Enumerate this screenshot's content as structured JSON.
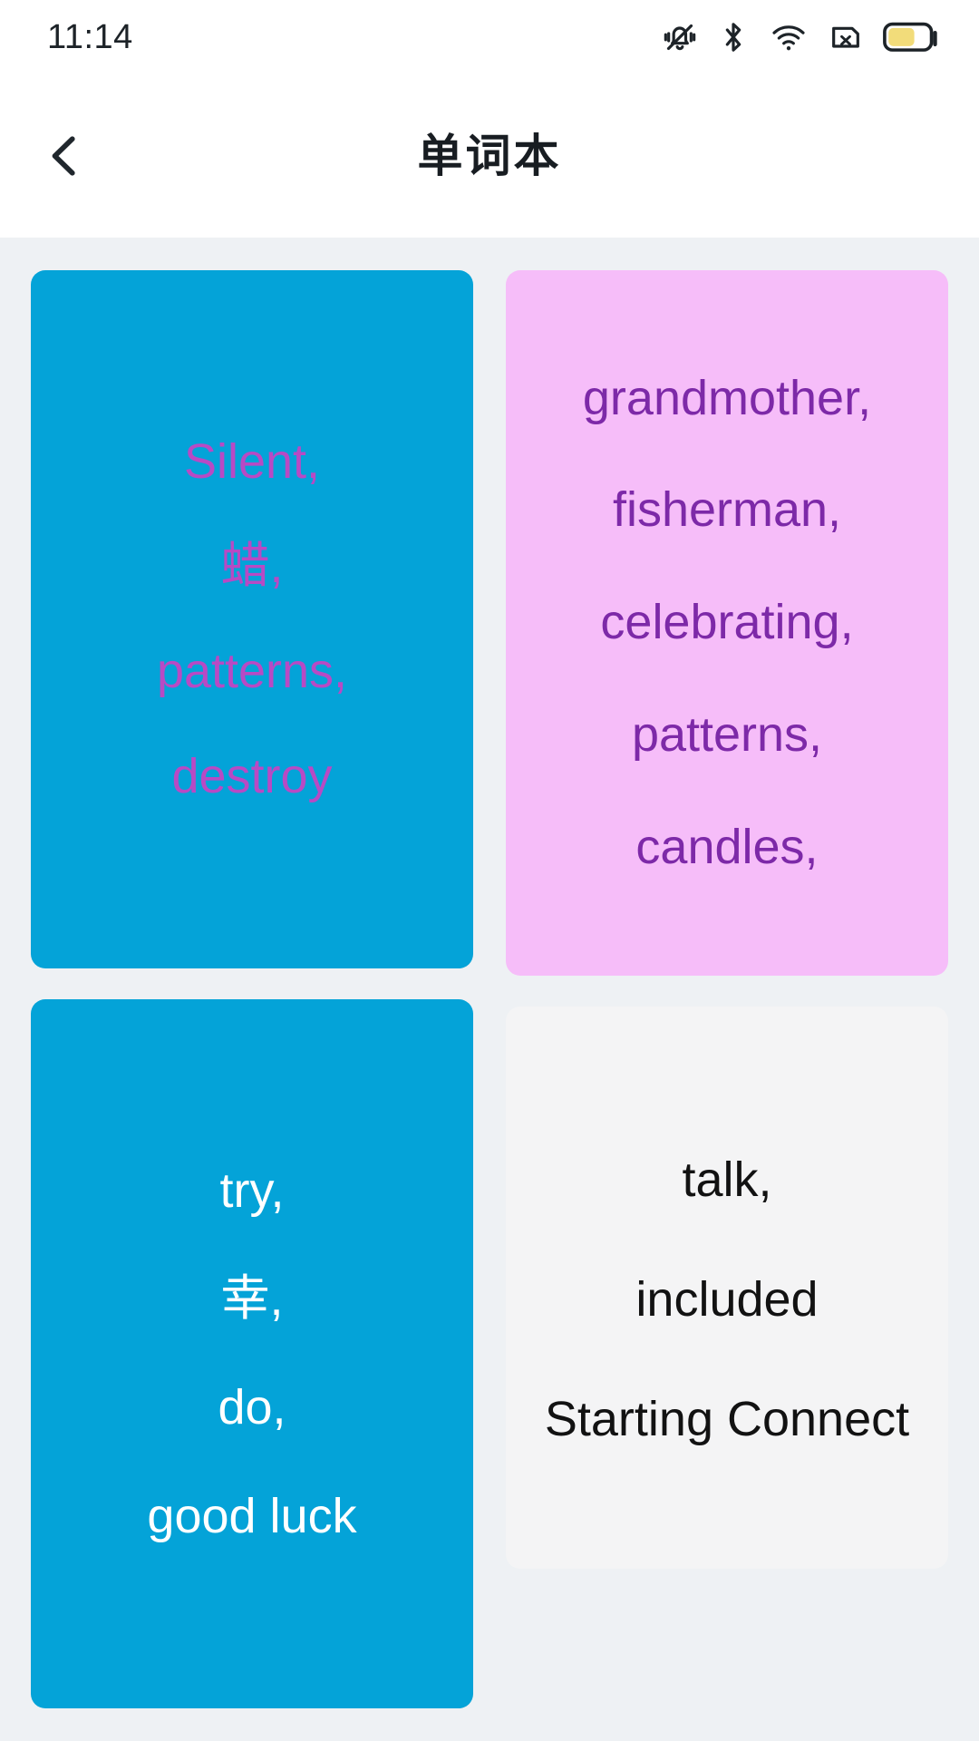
{
  "status_bar": {
    "time": "11:14",
    "icons": [
      "silent-bell-icon",
      "bluetooth-icon",
      "wifi-icon",
      "sim-card-off-icon",
      "battery-icon"
    ],
    "battery_level_percent": 60,
    "battery_color": "#f2dc7a"
  },
  "header": {
    "back_icon": "chevron-left-icon",
    "title": "单词本"
  },
  "theme": {
    "page_background": "#eef1f4",
    "header_background": "#ffffff",
    "card_blue": "#04a3d8",
    "card_pink": "#f6bdf9",
    "card_white": "#f4f4f5",
    "text_magenta": "#b84ac4",
    "text_purple": "#7d29a8",
    "text_white": "#ffffff",
    "text_black": "#121212"
  },
  "cards": [
    {
      "id": "card-1",
      "column": "left",
      "background": "#04a3d8",
      "text_color": "#b84ac4",
      "words": [
        "Silent,",
        "蜡,",
        "patterns,",
        "destroy"
      ]
    },
    {
      "id": "card-2",
      "column": "left",
      "background": "#04a3d8",
      "text_color": "#ffffff",
      "words": [
        "try,",
        "幸,",
        "do,",
        "good luck"
      ]
    },
    {
      "id": "card-3",
      "column": "right",
      "background": "#f6bdf9",
      "text_color": "#7d29a8",
      "words": [
        "grandmother,",
        "fisherman,",
        "celebrating,",
        "patterns,",
        "candles,"
      ]
    },
    {
      "id": "card-4",
      "column": "right",
      "background": "#f4f4f5",
      "text_color": "#121212",
      "words": [
        "talk,",
        "included",
        "Starting Connect"
      ]
    }
  ]
}
